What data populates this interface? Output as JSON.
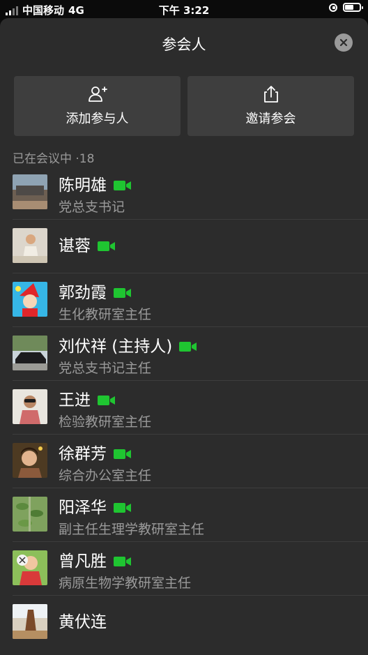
{
  "status": {
    "carrier": "中国移动",
    "network": "4G",
    "time": "下午 3:22"
  },
  "header": {
    "title": "参会人"
  },
  "actions": [
    {
      "label": "添加参与人",
      "icon": "add-person-icon"
    },
    {
      "label": "邀请参会",
      "icon": "share-icon"
    }
  ],
  "section": {
    "label": "已在会议中 ·18"
  },
  "participants": [
    {
      "name": "陈明雄",
      "role": "党总支书记",
      "video": true
    },
    {
      "name": "谌蓉",
      "role": "",
      "video": true
    },
    {
      "name": "郭劲霞",
      "role": "生化教研室主任",
      "video": true
    },
    {
      "name": "刘伏祥 (主持人)",
      "role": "党总支书记主任",
      "video": true
    },
    {
      "name": "王进",
      "role": "检验教研室主任",
      "video": true
    },
    {
      "name": "徐群芳",
      "role": "综合办公室主任",
      "video": true
    },
    {
      "name": "阳泽华",
      "role": "副主任生理学教研室主任",
      "video": true
    },
    {
      "name": "曾凡胜",
      "role": "病原生物学教研室主任",
      "video": true
    },
    {
      "name": "黄伏连",
      "role": "",
      "video": false
    }
  ],
  "colors": {
    "sheet": "#2c2c2c",
    "button": "#3e3e3e",
    "video_green": "#1fc531",
    "secondary_text": "#9a9a9a"
  }
}
